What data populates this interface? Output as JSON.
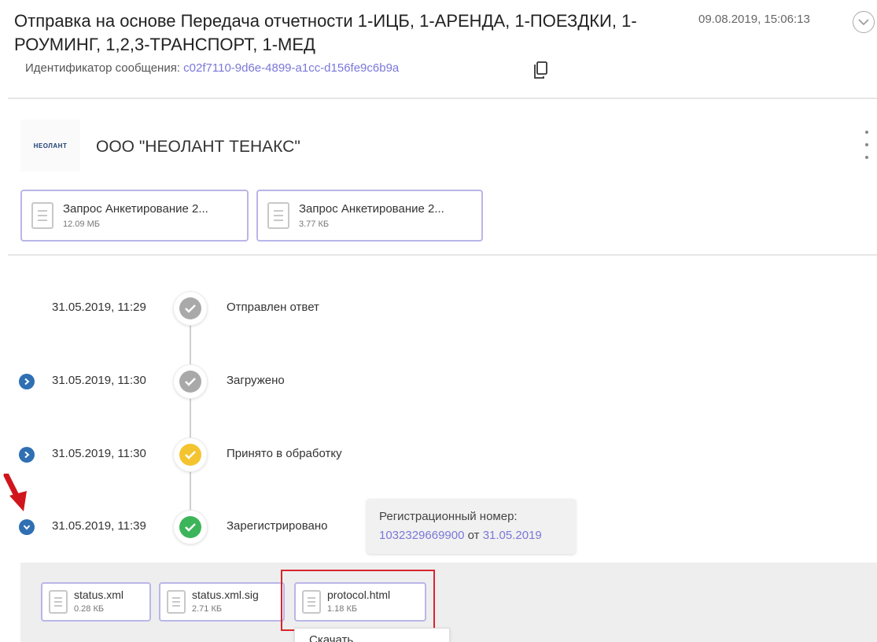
{
  "header": {
    "title": "Отправка на основе Передача отчетности 1-ИЦБ, 1-АРЕНДА, 1-ПОЕЗДКИ, 1-РОУМИНГ, 1,2,3-ТРАНСПОРТ, 1-МЕД",
    "date": "09.08.2019, 15:06:13",
    "message_id_label": "Идентификатор сообщения:",
    "message_id": "c02f7110-9d6e-4899-a1cc-d156fe9c6b9a"
  },
  "organization": {
    "logo_text": "НЕОЛАНТ",
    "name": "ООО \"НЕОЛАНТ ТЕНАКС\""
  },
  "attachments": [
    {
      "name": "Запрос Анкетирование 2...",
      "size": "12.09 МБ"
    },
    {
      "name": "Запрос Анкетирование 2...",
      "size": "3.77 КБ"
    }
  ],
  "timeline": [
    {
      "time": "31.05.2019, 11:29",
      "label": "Отправлен ответ",
      "status": "grey",
      "color": "#a9a9a9"
    },
    {
      "time": "31.05.2019, 11:30",
      "label": "Загружено",
      "status": "grey",
      "color": "#a9a9a9"
    },
    {
      "time": "31.05.2019, 11:30",
      "label": "Принято в обработку",
      "status": "yellow",
      "color": "#f4c430"
    },
    {
      "time": "31.05.2019, 11:39",
      "label": "Зарегистрировано",
      "status": "green",
      "color": "#3cb55a"
    }
  ],
  "registration": {
    "title": "Регистрационный номер:",
    "number": "1032329669900",
    "from_label": "от",
    "date": "31.05.2019"
  },
  "result_files": [
    {
      "name": "status.xml",
      "size": "0.28 КБ"
    },
    {
      "name": "status.xml.sig",
      "size": "2.71 КБ"
    },
    {
      "name": "protocol.html",
      "size": "1.18 КБ"
    }
  ],
  "dropdown": {
    "download_label": "Скачать"
  },
  "colors": {
    "accent": "#7a78d8",
    "card_border": "#b9b6e8",
    "expander": "#2f6fb3",
    "highlight": "#d9262c",
    "arrow": "#d0161c"
  }
}
